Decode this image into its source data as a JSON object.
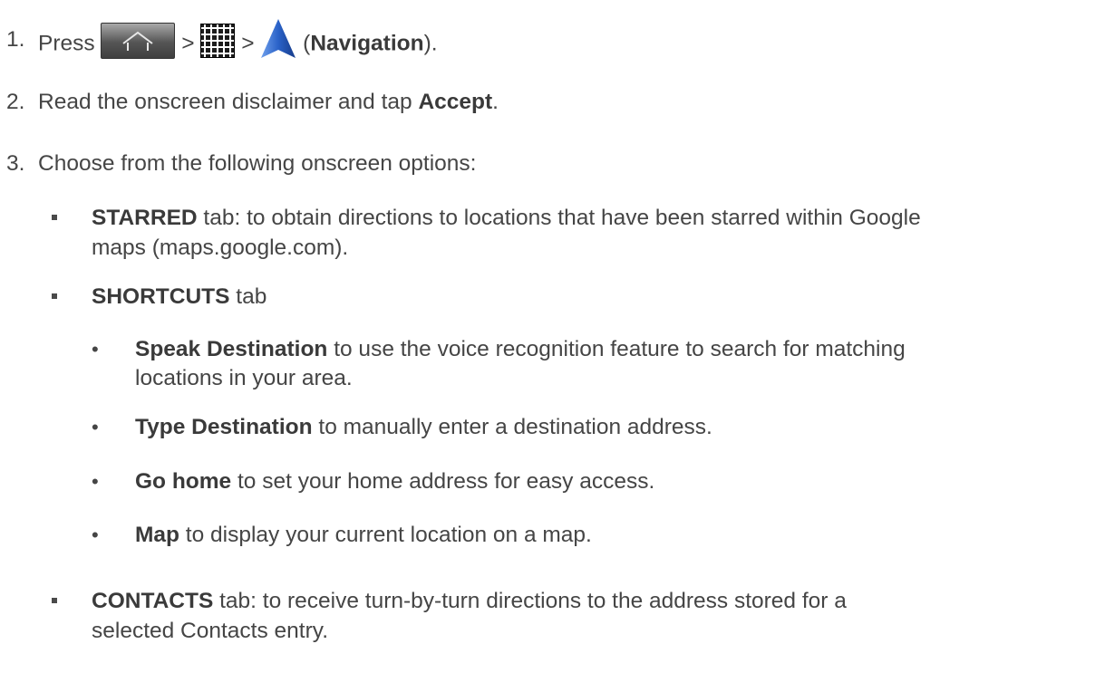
{
  "steps": [
    {
      "number": "1.",
      "text_before": "Press",
      "sep1": ">",
      "sep2": ">",
      "paren_open": "(",
      "bold": "Navigation",
      "paren_close": ")."
    },
    {
      "number": "2.",
      "text_before": "Read the onscreen disclaimer and tap ",
      "bold": "Accept",
      "text_after": "."
    },
    {
      "number": "3.",
      "text": "Choose from the following onscreen options:"
    }
  ],
  "options": [
    {
      "bold": "STARRED",
      "text_line1": " tab: to obtain directions to locations that have been starred within Google",
      "text_line2": "maps (maps.google.com)."
    },
    {
      "bold": "SHORTCUTS",
      "text": " tab",
      "sub_items": [
        {
          "bold": "Speak Destination",
          "text_line1": " to use the voice recognition feature to search for matching",
          "text_line2": "locations in your area."
        },
        {
          "bold": "Type Destination",
          "text_line1": " to manually enter a destination address."
        },
        {
          "bold": "Go home",
          "text_line1": " to set your home address for easy access."
        },
        {
          "bold": "Map",
          "text_line1": " to display your current location on a map."
        }
      ]
    },
    {
      "bold": "CONTACTS",
      "text_line1": " tab: to receive turn-by-turn directions to the address stored for a",
      "text_line2": "selected Contacts entry."
    }
  ],
  "icons": {
    "home": "home-key-icon",
    "apps": "apps-grid-icon",
    "navigation": "navigation-arrow-icon",
    "navigation_color": "#2a62c8"
  }
}
